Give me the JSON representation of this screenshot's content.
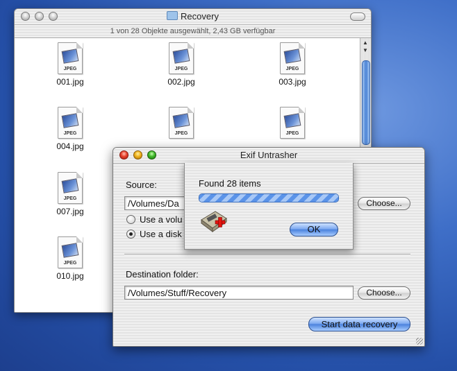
{
  "finder": {
    "title": "Recovery",
    "info": "1 von 28 Objekte ausgewählt, 2,43 GB verfügbar",
    "file_type_tag": "JPEG",
    "files": [
      "001.jpg",
      "002.jpg",
      "003.jpg",
      "004.jpg",
      "",
      "",
      "007.jpg",
      "",
      "",
      "010.jpg"
    ]
  },
  "exif": {
    "title": "Exif Untrasher",
    "source_label": "Source:",
    "source_path": "/Volumes/Da",
    "choose_label": "Choose...",
    "option_volume": "Use a volu",
    "option_disk": "Use a disk",
    "dest_label": "Destination folder:",
    "dest_path": "/Volumes/Stuff/Recovery",
    "start_label": "Start data recovery"
  },
  "sheet": {
    "status": "Found 28 items",
    "progress": 1.0,
    "ok_label": "OK"
  },
  "colors": {
    "desktop": "#3f6fc8",
    "aqua_blue": "#4c83de"
  }
}
